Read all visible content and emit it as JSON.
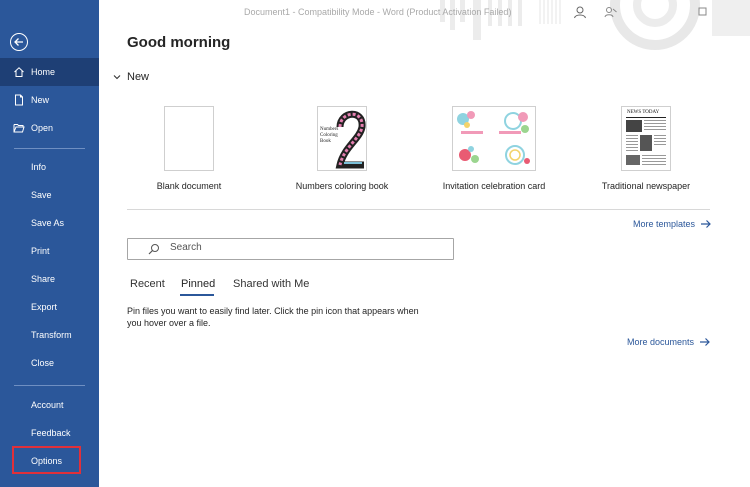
{
  "window": {
    "title": "Document1  -  Compatibility Mode  -  Word (Product Activation Failed)"
  },
  "sidebar": {
    "back_icon": "back-arrow-icon",
    "items": [
      {
        "label": "Home",
        "icon": "home-icon",
        "active": true
      },
      {
        "label": "New",
        "icon": "new-document-icon"
      },
      {
        "label": "Open",
        "icon": "folder-open-icon"
      },
      {
        "label": "Info"
      },
      {
        "label": "Save"
      },
      {
        "label": "Save As"
      },
      {
        "label": "Print"
      },
      {
        "label": "Share"
      },
      {
        "label": "Export"
      },
      {
        "label": "Transform"
      },
      {
        "label": "Close"
      },
      {
        "label": "Account"
      },
      {
        "label": "Feedback"
      },
      {
        "label": "Options",
        "highlighted": true
      }
    ]
  },
  "main": {
    "greeting": "Good morning",
    "new_section": {
      "label": "New",
      "templates": [
        {
          "label": "Blank document"
        },
        {
          "label": "Numbers coloring book",
          "thumb_text": "Numbers Coloring Book"
        },
        {
          "label": "Invitation celebration card"
        },
        {
          "label": "Traditional newspaper",
          "thumb_text": "NEWS TODAY"
        }
      ],
      "more_templates": "More templates"
    },
    "search": {
      "placeholder": "Search"
    },
    "tabs": [
      {
        "label": "Recent"
      },
      {
        "label": "Pinned",
        "active": true
      },
      {
        "label": "Shared with Me"
      }
    ],
    "pinned_message": "Pin files you want to easily find later. Click the pin icon that appears when you hover over a file.",
    "more_documents": "More documents"
  },
  "colors": {
    "sidebar_bg": "#2b579a",
    "sidebar_active": "#1e3f75",
    "accent": "#2b579a",
    "highlight_box": "#e0303a"
  }
}
